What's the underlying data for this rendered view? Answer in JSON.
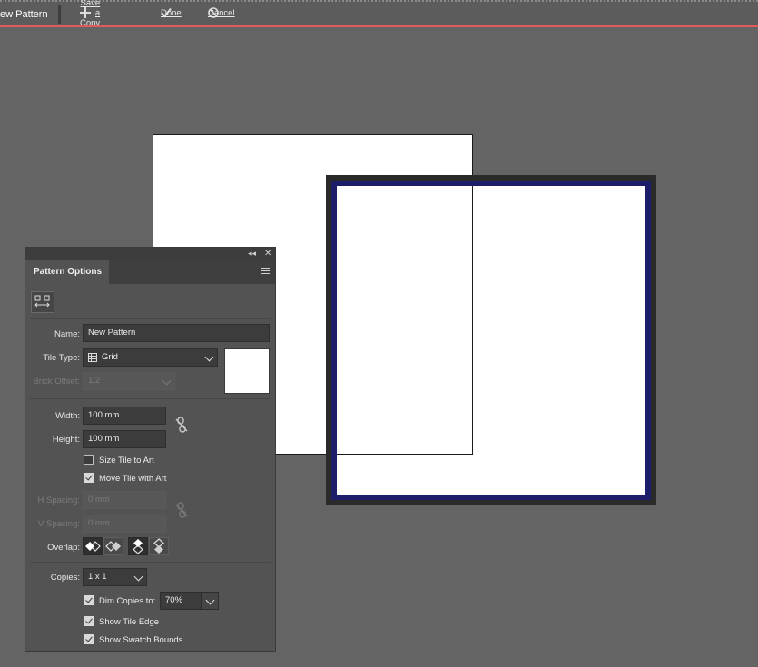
{
  "topbar": {
    "mode_label": "ew Pattern",
    "save_copy_label": "Save a Copy",
    "done_label": "Done",
    "cancel_label": "Cancel"
  },
  "panel": {
    "title": "Pattern Options",
    "name_label": "Name:",
    "name_value": "New Pattern",
    "tile_type_label": "Tile Type:",
    "tile_type_value": "Grid",
    "brick_offset_label": "Brick Offset:",
    "brick_offset_value": "1/2",
    "width_label": "Width:",
    "width_value": "100 mm",
    "height_label": "Height:",
    "height_value": "100 mm",
    "size_tile_to_art_label": "Size Tile to Art",
    "size_tile_to_art_checked": false,
    "move_tile_with_art_label": "Move Tile with Art",
    "move_tile_with_art_checked": true,
    "h_spacing_label": "H Spacing:",
    "h_spacing_value": "0 mm",
    "v_spacing_label": "V Spacing:",
    "v_spacing_value": "0 mm",
    "overlap_label": "Overlap:",
    "copies_label": "Copies:",
    "copies_value": "1 x 1",
    "dim_copies_label": "Dim Copies to:",
    "dim_copies_checked": true,
    "dim_copies_value": "70%",
    "show_tile_edge_label": "Show Tile Edge",
    "show_tile_edge_checked": true,
    "show_swatch_bounds_label": "Show Swatch Bounds",
    "show_swatch_bounds_checked": true
  },
  "colors": {
    "canvas": "#646464",
    "accent_line": "#e05a5a",
    "swatch_bounds": "#1d1d6a"
  }
}
